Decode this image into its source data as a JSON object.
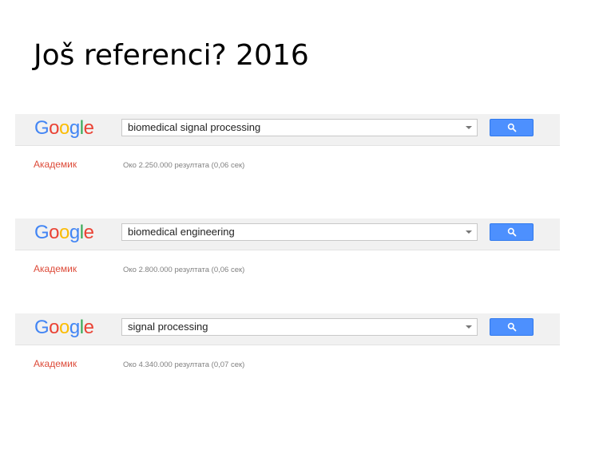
{
  "slide": {
    "title": "Još referenci? 2016"
  },
  "logo": {
    "letters": [
      "G",
      "o",
      "o",
      "g",
      "l",
      "e"
    ],
    "colors": [
      "#4285f4",
      "#ea4335",
      "#fbbc05",
      "#4285f4",
      "#34a853",
      "#ea4335"
    ]
  },
  "accent": {
    "button": "#4d90fe",
    "scholar": "#dd4b39"
  },
  "searches": [
    {
      "query": "biomedical signal processing",
      "scholar_label": "Академик",
      "results": "Око 2.250.000 резултата (0,06 сек)"
    },
    {
      "query": "biomedical engineering",
      "scholar_label": "Академик",
      "results": "Око 2.800.000 резултата (0,06 сек)"
    },
    {
      "query": "signal processing",
      "scholar_label": "Академик",
      "results": "Око 4.340.000 резултата (0,07 сек)"
    }
  ]
}
